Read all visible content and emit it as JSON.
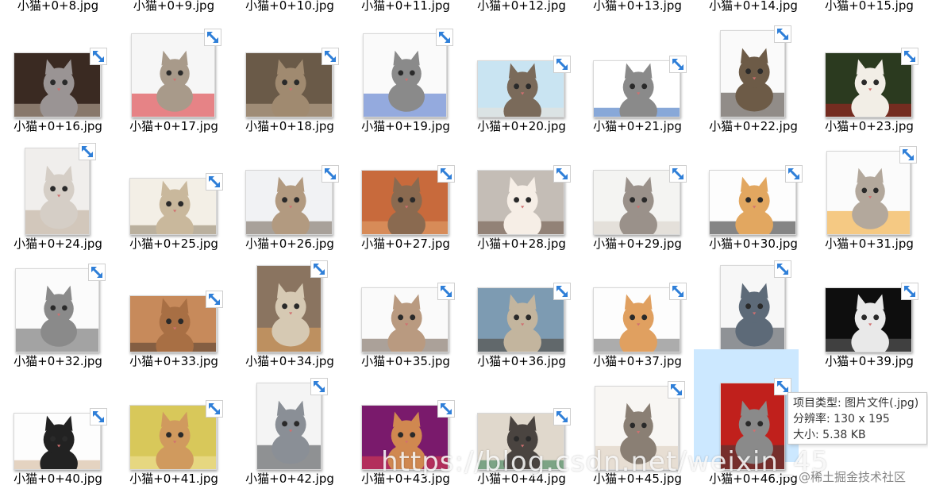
{
  "files": [
    {
      "name": "小猫+0+8.jpg",
      "thumb": null,
      "colors": []
    },
    {
      "name": "小猫+0+9.jpg",
      "thumb": null,
      "colors": []
    },
    {
      "name": "小猫+0+10.jpg",
      "thumb": null,
      "colors": []
    },
    {
      "name": "小猫+0+11.jpg",
      "thumb": null,
      "colors": []
    },
    {
      "name": "小猫+0+12.jpg",
      "thumb": null,
      "colors": []
    },
    {
      "name": "小猫+0+13.jpg",
      "thumb": null,
      "colors": []
    },
    {
      "name": "小猫+0+14.jpg",
      "thumb": null,
      "colors": []
    },
    {
      "name": "小猫+0+15.jpg",
      "thumb": null,
      "colors": []
    },
    {
      "name": "小猫+0+16.jpg",
      "orient": "land",
      "colors": [
        "#3a2a22",
        "#9a9494",
        "#c9b8a8"
      ]
    },
    {
      "name": "小猫+0+17.jpg",
      "orient": "square",
      "colors": [
        "#f6f6f6",
        "#a89a8a",
        "#d8252a"
      ]
    },
    {
      "name": "小猫+0+18.jpg",
      "orient": "land",
      "colors": [
        "#6a5a48",
        "#a08a70",
        "#cbb79c"
      ]
    },
    {
      "name": "小猫+0+19.jpg",
      "orient": "square",
      "colors": [
        "#fafafa",
        "#8a8a8a",
        "#3f67c6"
      ]
    },
    {
      "name": "小猫+0+20.jpg",
      "orient": "wide",
      "colors": [
        "#c9e4f2",
        "#7a6a5a",
        "#e9e2d8"
      ]
    },
    {
      "name": "小猫+0+21.jpg",
      "orient": "wide",
      "colors": [
        "#ffffff",
        "#8a8a8a",
        "#2660b8"
      ]
    },
    {
      "name": "小猫+0+22.jpg",
      "orient": "tall",
      "colors": [
        "#fafafa",
        "#6d5b47",
        "#3a3129"
      ]
    },
    {
      "name": "小猫+0+23.jpg",
      "orient": "land",
      "colors": [
        "#2b3a1f",
        "#f2eee6",
        "#b12020"
      ]
    },
    {
      "name": "小猫+0+24.jpg",
      "orient": "tall",
      "colors": [
        "#f0eeec",
        "#d5cec6",
        "#b9a894"
      ]
    },
    {
      "name": "小猫+0+25.jpg",
      "orient": "wide",
      "colors": [
        "#f3efe6",
        "#c9b89c",
        "#8b7b63"
      ]
    },
    {
      "name": "小猫+0+26.jpg",
      "orient": "land",
      "colors": [
        "#f1f2f4",
        "#b29a80",
        "#6b5e50"
      ]
    },
    {
      "name": "小猫+0+27.jpg",
      "orient": "land",
      "colors": [
        "#c86a3c",
        "#8a6a50",
        "#e3a570"
      ]
    },
    {
      "name": "小猫+0+28.jpg",
      "orient": "land",
      "colors": [
        "#c4bdb6",
        "#f6eee6",
        "#6a5244"
      ]
    },
    {
      "name": "小猫+0+29.jpg",
      "orient": "land",
      "colors": [
        "#f4f4f2",
        "#9a918a",
        "#d7d0c6"
      ]
    },
    {
      "name": "小猫+0+30.jpg",
      "orient": "land",
      "colors": [
        "#fdfdfd",
        "#e2a760",
        "#222222"
      ]
    },
    {
      "name": "小猫+0+31.jpg",
      "orient": "square",
      "colors": [
        "#fbfbfb",
        "#b3a89c",
        "#f0a020"
      ]
    },
    {
      "name": "小猫+0+32.jpg",
      "orient": "square",
      "colors": [
        "#fbfbfb",
        "#8a8a8a",
        "#5b5b5b"
      ]
    },
    {
      "name": "小猫+0+33.jpg",
      "orient": "wide",
      "colors": [
        "#c78a5b",
        "#a86f44",
        "#4c3a2e"
      ]
    },
    {
      "name": "小猫+0+34.jpg",
      "orient": "tall",
      "colors": [
        "#8a7460",
        "#d6c9b3",
        "#e8a860"
      ]
    },
    {
      "name": "小猫+0+35.jpg",
      "orient": "land",
      "colors": [
        "#fafafa",
        "#b99a80",
        "#6a5848"
      ]
    },
    {
      "name": "小猫+0+36.jpg",
      "orient": "land",
      "colors": [
        "#7d9bb2",
        "#c3b59e",
        "#4a3e32"
      ]
    },
    {
      "name": "小猫+0+37.jpg",
      "orient": "land",
      "colors": [
        "#fdfdfd",
        "#e0a060",
        "#6a6a6a"
      ]
    },
    {
      "name": "小猫+0+38.jpg",
      "orient": "tall",
      "colors": [
        "#f7f7f7",
        "#5d6a78",
        "#3a3f47"
      ]
    },
    {
      "name": "小猫+0+39.jpg",
      "orient": "land",
      "colors": [
        "#0e0e0e",
        "#e9e9e9",
        "#6a6a6a"
      ]
    },
    {
      "name": "小猫+0+40.jpg",
      "orient": "wide",
      "colors": [
        "#fdfdfd",
        "#222222",
        "#d0b090"
      ]
    },
    {
      "name": "小猫+0+41.jpg",
      "orient": "land",
      "colors": [
        "#d8c85a",
        "#d09a5e",
        "#f2e3a0"
      ]
    },
    {
      "name": "小猫+0+42.jpg",
      "orient": "tall",
      "colors": [
        "#f4f4f4",
        "#8a8f96",
        "#3c3f44"
      ]
    },
    {
      "name": "小猫+0+43.jpg",
      "orient": "land",
      "colors": [
        "#7a1a6c",
        "#d08850",
        "#e24050"
      ]
    },
    {
      "name": "小猫+0+44.jpg",
      "orient": "wide",
      "colors": [
        "#e0d8cc",
        "#4a4440",
        "#2a7a4a"
      ]
    },
    {
      "name": "小猫+0+45.jpg",
      "orient": "square",
      "colors": [
        "#f8f6f3",
        "#8a7f74",
        "#d9cbb8"
      ]
    },
    {
      "name": "小猫+0+46.jpg",
      "orient": "tall",
      "colors": [
        "#c0201c",
        "#8a8a8a",
        "#3a3a3a"
      ],
      "selected": true
    }
  ],
  "tooltip": {
    "type_line": "项目类型: 图片文件(.jpg)",
    "resolution_line": "分辨率: 130 x 195",
    "size_line": "大小: 5.38 KB"
  },
  "watermark": {
    "url_text": "https://blog.csdn.net/weixin_45",
    "site_text": "@稀土掘金技术社区"
  }
}
